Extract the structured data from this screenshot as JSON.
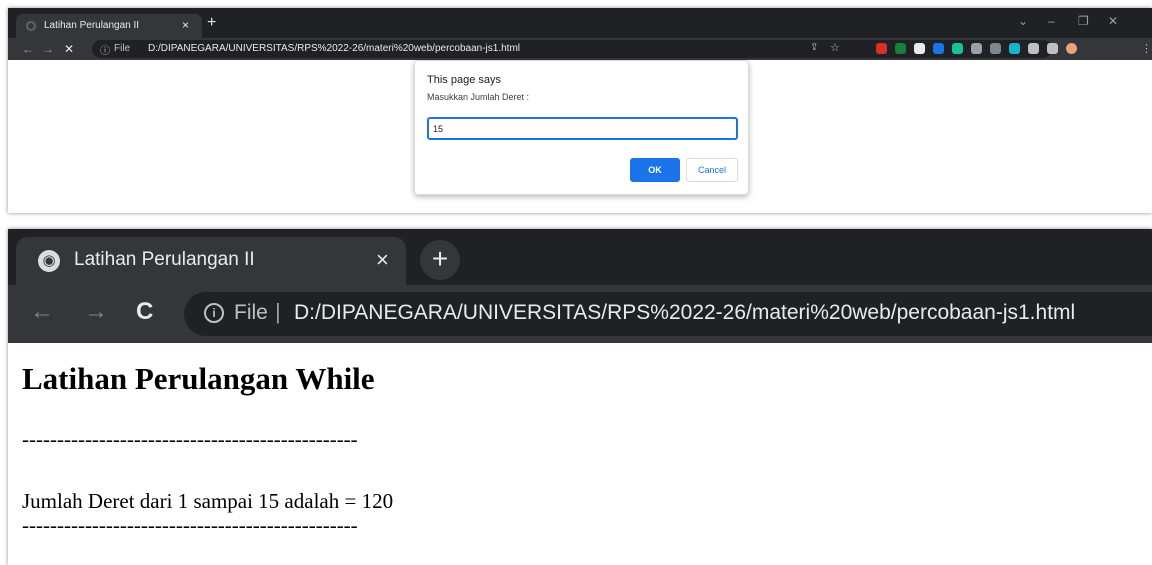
{
  "shot1": {
    "tab": {
      "title": "Latihan Perulangan II",
      "close": "×",
      "new_tab": "+"
    },
    "window_controls": [
      "⌄",
      "–",
      "❐",
      "✕"
    ],
    "toolbar": {
      "back": "←",
      "forward": "→",
      "stop": "✕",
      "info_icon": "ⓘ",
      "file_label": "File",
      "url": "D:/DIPANEGARA/UNIVERSITAS/RPS%2022-26/materi%20web/percobaan-js1.html",
      "share_icon": "⇪",
      "star_icon": "☆",
      "menu_icon": "⋮"
    },
    "extensions": [
      {
        "name": "ext-red-icon",
        "color": "#d93025"
      },
      {
        "name": "ext-green-icon",
        "color": "#188038"
      },
      {
        "name": "ext-doc-icon",
        "color": "#e8eaed"
      },
      {
        "name": "ext-blue-icon",
        "color": "#1a73e8"
      },
      {
        "name": "ext-grammarly-icon",
        "color": "#15c39a"
      },
      {
        "name": "ext-gray-icon",
        "color": "#9aa0a6"
      },
      {
        "name": "ext-gray2-icon",
        "color": "#80868b"
      },
      {
        "name": "ext-teal-icon",
        "color": "#12b5cb"
      },
      {
        "name": "ext-puzzle-icon",
        "color": "#bdc1c6"
      },
      {
        "name": "ext-sidepanel-icon",
        "color": "#bdc1c6"
      },
      {
        "name": "ext-avatar-icon",
        "color": "#e6a37c"
      }
    ],
    "dialog": {
      "title": "This page says",
      "message": "Masukkan Jumlah Deret :",
      "input_value": "15",
      "ok_label": "OK",
      "cancel_label": "Cancel"
    }
  },
  "shot2": {
    "tab": {
      "title": "Latihan Perulangan II",
      "close": "×",
      "new_tab": "+",
      "globe_icon": "◉"
    },
    "toolbar": {
      "back": "←",
      "forward": "→",
      "reload": "C",
      "info_icon": "i",
      "file_label": "File",
      "separator": "|",
      "url": "D:/DIPANEGARA/UNIVERSITAS/RPS%2022-26/materi%20web/percobaan-js1.html"
    },
    "content": {
      "heading": "Latihan Perulangan While",
      "divider_top": "------------------------------------------------",
      "result": "Jumlah Deret dari 1 sampai 15 adalah = 120",
      "divider_bottom": "------------------------------------------------"
    }
  }
}
